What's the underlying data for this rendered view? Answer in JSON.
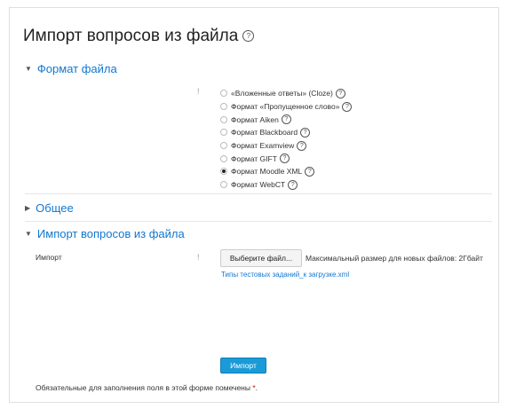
{
  "page": {
    "title": "Импорт вопросов из файла",
    "help_glyph": "?"
  },
  "sections": {
    "file_format": {
      "label": "Формат файла",
      "expanded": true
    },
    "general": {
      "label": "Общее",
      "expanded": false
    },
    "import": {
      "label": "Импорт вопросов из файла",
      "expanded": true
    }
  },
  "format_options": [
    {
      "label": "«Вложенные ответы» (Cloze)",
      "checked": false
    },
    {
      "label": "Формат «Пропущенное слово»",
      "checked": false
    },
    {
      "label": "Формат Aiken",
      "checked": false
    },
    {
      "label": "Формат Blackboard",
      "checked": false
    },
    {
      "label": "Формат Examview",
      "checked": false
    },
    {
      "label": "Формат GIFT",
      "checked": false
    },
    {
      "label": "Формат Moodle XML",
      "checked": true
    },
    {
      "label": "Формат WebCT",
      "checked": false
    }
  ],
  "import_field": {
    "label": "Импорт",
    "choose_button": "Выберите файл...",
    "max_size": "Максимальный размер для новых файлов: 2Гбайт",
    "selected_file": "Типы тестовых заданий_к загрузке.xml"
  },
  "submit_label": "Импорт",
  "required_note": "Обязательные для заполнения поля в этой форме помечены",
  "required_star": "*",
  "required_period": ".",
  "required_marker": "*",
  "colors": {
    "link": "#1177d1",
    "primary_button": "#1a9bd8",
    "required": "#c00000"
  },
  "icons": {
    "help": "question-circle-icon",
    "expanded": "caret-down-icon",
    "collapsed": "caret-right-icon",
    "required": "exclamation-icon"
  }
}
